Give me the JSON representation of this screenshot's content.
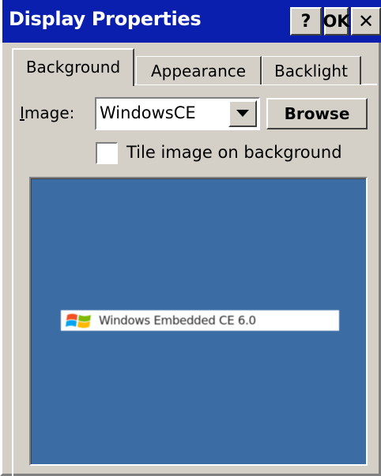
{
  "window": {
    "title": "Display Properties",
    "help_label": "?",
    "ok_label": "OK",
    "close_label": "✕"
  },
  "tabs": [
    {
      "label": "Background",
      "active": true
    },
    {
      "label": "Appearance",
      "active": false
    },
    {
      "label": "Backlight",
      "active": false
    }
  ],
  "background": {
    "image_label_prefix": "",
    "image_label_mnemonic": "I",
    "image_label_rest": "mage:",
    "image_value": "WindowsCE",
    "browse_label": "Browse",
    "tile_label": "Tile image on background",
    "tile_checked": false,
    "preview_text": "Windows Embedded CE 6.0"
  },
  "colors": {
    "titlebar": "#0a1fae",
    "preview_bg": "#3b6ca3",
    "face": "#d4d0c8"
  }
}
